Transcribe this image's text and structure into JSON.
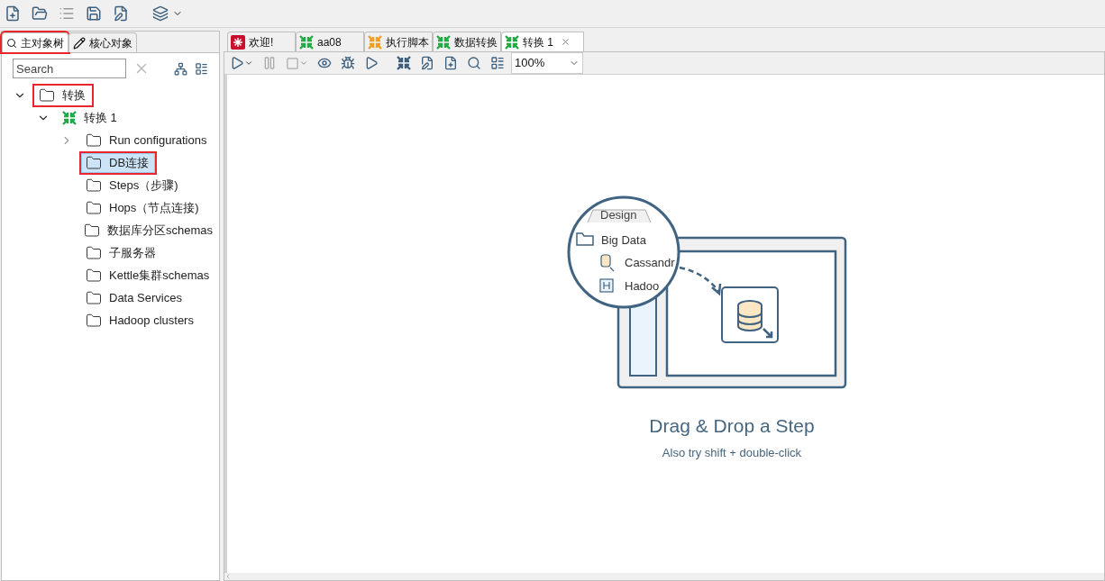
{
  "left_panel": {
    "tabs": [
      {
        "label": "主对象树",
        "selected": true,
        "highlighted": true
      },
      {
        "label": "核心对象",
        "selected": false,
        "highlighted": false
      }
    ],
    "search": {
      "placeholder": "Search"
    },
    "tree": [
      {
        "label": "转换",
        "kind": "folder",
        "expanded": true,
        "selected": false,
        "highlighted": true,
        "children": [
          {
            "label": "转换 1",
            "kind": "transformation",
            "expanded": true,
            "selected": false,
            "highlighted": false,
            "children": [
              {
                "label": "Run configurations",
                "kind": "folder",
                "expanded": false,
                "selected": false,
                "highlighted": false
              },
              {
                "label": "DB连接",
                "kind": "folder",
                "selected": true,
                "highlighted": true
              },
              {
                "label": "Steps（步骤)",
                "kind": "folder",
                "selected": false,
                "highlighted": false
              },
              {
                "label": "Hops（节点连接)",
                "kind": "folder",
                "selected": false,
                "highlighted": false
              },
              {
                "label": "数据库分区schemas",
                "kind": "folder",
                "selected": false,
                "highlighted": false
              },
              {
                "label": "子服务器",
                "kind": "folder",
                "selected": false,
                "highlighted": false
              },
              {
                "label": "Kettle集群schemas",
                "kind": "folder",
                "selected": false,
                "highlighted": false
              },
              {
                "label": "Data Services",
                "kind": "folder",
                "selected": false,
                "highlighted": false
              },
              {
                "label": "Hadoop clusters",
                "kind": "folder",
                "selected": false,
                "highlighted": false
              }
            ]
          }
        ]
      }
    ]
  },
  "editor": {
    "tabs": [
      {
        "label": "欢迎!",
        "kind": "welcome",
        "selected": false,
        "closable": false
      },
      {
        "label": "aa08",
        "kind": "transformation",
        "selected": false,
        "closable": false
      },
      {
        "label": "执行脚本",
        "kind": "job",
        "selected": false,
        "closable": false
      },
      {
        "label": "数据转换",
        "kind": "transformation",
        "selected": false,
        "closable": false
      },
      {
        "label": "转换 1",
        "kind": "transformation",
        "selected": true,
        "closable": true
      }
    ],
    "zoom": {
      "value": "100%"
    },
    "illustration": {
      "tab": "Design",
      "folder": "Big Data",
      "items": [
        "Cassandr",
        "Hadoo"
      ]
    },
    "hint": {
      "title": "Drag & Drop a Step",
      "subtitle": "Also try shift + double-click"
    }
  }
}
